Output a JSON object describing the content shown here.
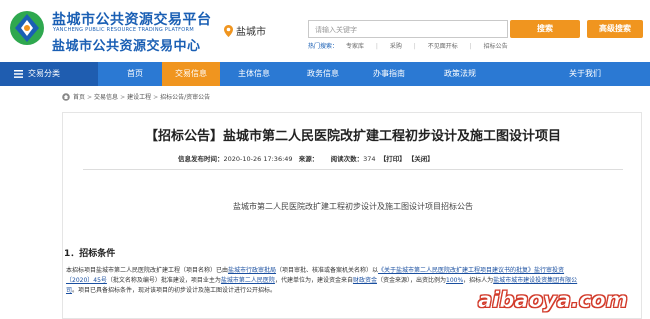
{
  "header": {
    "site_name": "盐城市公共资源交易平台",
    "site_name_en": "YANCHENG PUBLIC RESOURCE TRADING PLATFORM",
    "center_name": "盐城市公共资源交易中心",
    "location": "盐城市",
    "search_placeholder": "请输入关键字",
    "search_button": "搜索",
    "advanced_search_button": "高级搜索",
    "hot_label": "热门搜索：",
    "hot_items": [
      "专家库",
      "采购",
      "不见面开标",
      "招标公告"
    ],
    "brand_color": "#1a5fb4",
    "accent_color": "#f0951f"
  },
  "nav": {
    "category_label": "交易分类",
    "items": [
      "首页",
      "交易信息",
      "主体信息",
      "政务信息",
      "办事指南",
      "政策法规",
      "关于我们"
    ],
    "active_index": 1,
    "bar_color": "#2b79d3"
  },
  "breadcrumb": [
    "首页",
    "交易信息",
    "建设工程",
    "招标公告/资审公告"
  ],
  "article": {
    "title": "【招标公告】盐城市第二人民医院改扩建工程初步设计及施工图设计项目",
    "publish_label": "信息发布时间：",
    "publish_time": "2020-10-26 17:36:49",
    "source_label": "来源：",
    "views_label": "阅读次数：",
    "views": "374",
    "print_label": "【打印】",
    "close_label": "【关闭】",
    "doc_heading": "盐城市第二人民医院改扩建工程初步设计及施工图设计项目招标公告",
    "section1_title": "1．招标条件",
    "para1_part1": "本招标项目盐城市第二人民医院改扩建工程（项目名称）已由",
    "para1_approver": "盐城市行政审批局",
    "para1_part2": "（项目审批、核准或备案机关名称）以",
    "para1_doc": "《关于盐城市第二人民医院改扩建工程项目建议书的批复》盐行审投资〔2020〕45号",
    "para1_part3": "（批文名称及编号）批准建设，项目业主为",
    "para1_owner": "盐城市第二人民医院",
    "para1_part4": "，代建单位为",
    "para1_part5": "，建设资金来自",
    "para1_fund": "财政资金",
    "para1_part6": "（资金来源），出资比例为",
    "para1_ratio": "100%",
    "para1_part7": "，招标人为",
    "para1_tenderer": "盐城市城市建设投资集团有限公司",
    "para1_part8": "。项目已具备招标条件，现对该项目的初步设计及施工图设计进行公开招标。"
  },
  "watermark": "aibaoya.com"
}
